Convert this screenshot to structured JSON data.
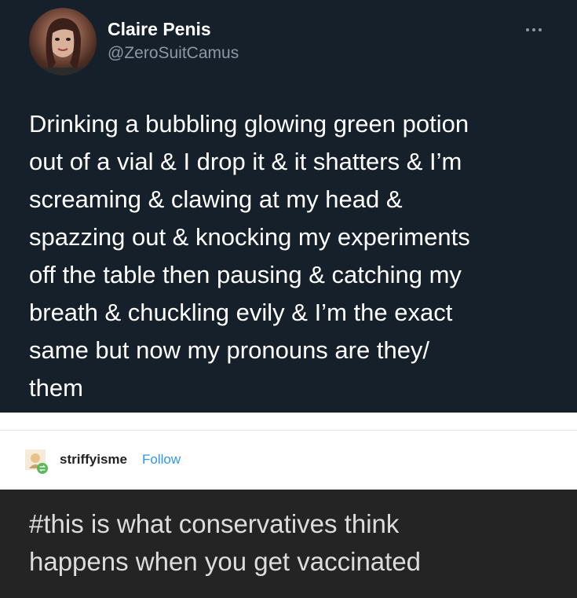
{
  "tweet": {
    "display_name": "Claire Penis",
    "handle": "@ZeroSuitCamus",
    "avatar_icon": "profile-photo",
    "more_icon": "more-horizontal-icon",
    "text": "Drinking a bubbling glowing green potion\nout of a vial & I drop it & it shatters & I’m\nscreaming & clawing at my head &\nspazzing out & knocking my experiments\noff the table then pausing & catching my\nbreath & chuckling evily & I’m the exact\nsame but now my pronouns are they/\nthem",
    "background_color": "#15202b"
  },
  "reblog": {
    "username": "striffyisme",
    "follow_label": "Follow",
    "follow_color": "#2f97e6",
    "reblog_badge_color": "#5cb85c"
  },
  "comment": {
    "text": "#this is what conservatives think\nhappens when you get vaccinated",
    "background_color": "#242424"
  }
}
